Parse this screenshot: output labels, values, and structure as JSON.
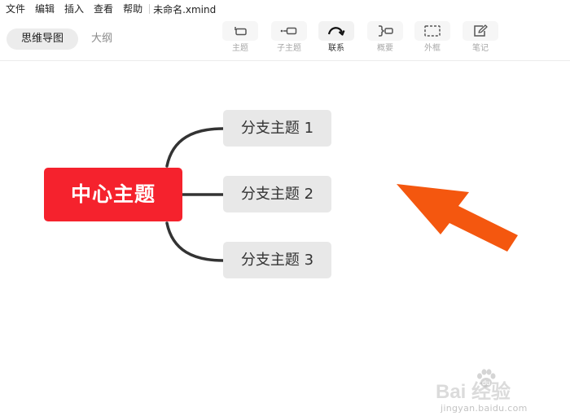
{
  "menu": {
    "items": [
      "文件",
      "编辑",
      "插入",
      "查看",
      "帮助"
    ],
    "document_title": "未命名.xmind"
  },
  "view_tabs": {
    "mindmap": "思维导图",
    "outline": "大纲",
    "active": "mindmap"
  },
  "toolbar": {
    "tools": [
      {
        "label": "主题",
        "icon": "topic-icon"
      },
      {
        "label": "子主题",
        "icon": "subtopic-icon"
      },
      {
        "label": "联系",
        "icon": "relationship-icon",
        "active": true
      },
      {
        "label": "概要",
        "icon": "summary-icon"
      },
      {
        "label": "外框",
        "icon": "boundary-icon"
      },
      {
        "label": "笔记",
        "icon": "note-icon"
      }
    ]
  },
  "mindmap": {
    "central_topic": "中心主题",
    "central_color": "#f5222d",
    "branches": [
      "分支主题 1",
      "分支主题 2",
      "分支主题 3"
    ]
  },
  "annotation": {
    "arrow_color": "#f4570f"
  },
  "watermark": {
    "brand": "Bai  经验",
    "site": "jingyan.baidu.com"
  }
}
